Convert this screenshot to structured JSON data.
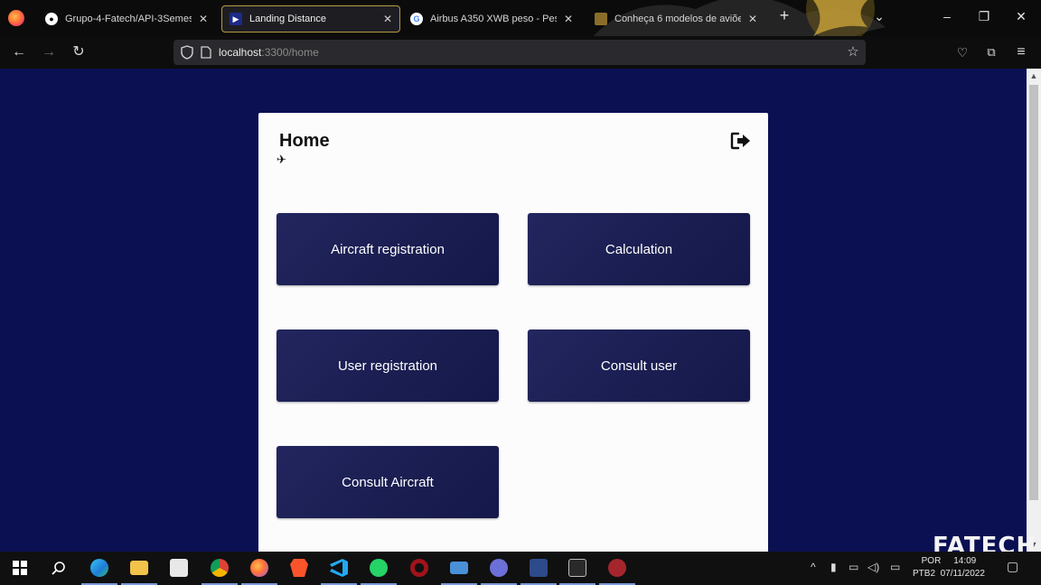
{
  "browser": {
    "tabs": [
      {
        "label": "Grupo-4-Fatech/API-3Semestre",
        "icon": "github-icon",
        "active": false
      },
      {
        "label": "Landing Distance",
        "icon": "app-icon",
        "active": true
      },
      {
        "label": "Airbus A350 XWB peso - Pesq",
        "icon": "google-icon",
        "active": false
      },
      {
        "label": "Conheça 6 modelos de aviões e",
        "icon": "page-icon",
        "active": false
      }
    ],
    "url_host": "localhost",
    "url_rest": ":3300/home"
  },
  "page": {
    "title": "Home",
    "buttons": {
      "aircraft_registration": "Aircraft registration",
      "calculation": "Calculation",
      "user_registration": "User registration",
      "consult_user": "Consult user",
      "consult_aircraft": "Consult Aircraft"
    },
    "colors": {
      "background": "#0b1053",
      "card": "#fcfcfd",
      "button": "#1c1f55"
    }
  },
  "watermark": "FATECH",
  "taskbar": {
    "lang_top": "POR",
    "lang_bottom": "PTB2",
    "time": "14:09",
    "date": "07/11/2022"
  }
}
